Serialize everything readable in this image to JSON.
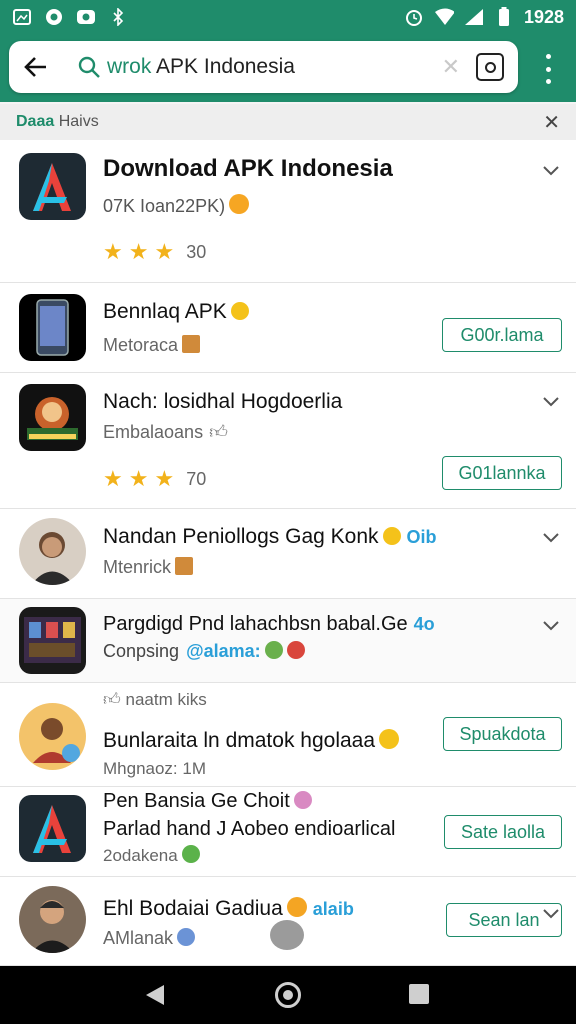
{
  "status": {
    "time": "1928"
  },
  "search": {
    "query_prefix": "wrok",
    "query_rest": " APK Indonesia"
  },
  "filter": {
    "label_bold": "Daaa",
    "label_rest": " Haivs"
  },
  "items": [
    {
      "title": "Download APK Indonesia",
      "subtitle": "07K Ioan22PK)",
      "stars": 3,
      "rating": "30"
    },
    {
      "title": "Bennlaq APK",
      "subtitle": "Metoraca",
      "button": "G00r.lama"
    },
    {
      "title": "Nach: losidhal Hogdoerlia",
      "subtitle": "Embalaoans",
      "stars": 3,
      "rating": "70",
      "button": "G01lannka"
    },
    {
      "title": "Nandan Peniollogs Gag Konk",
      "tag": "Oib",
      "subtitle": "Mtenrick"
    },
    {
      "title": "Pargdigd Pnd lahachbsn babal.Ge",
      "tag": "4o",
      "subtitle": "Conpsing",
      "subtitle_tag": "@alama:"
    },
    {
      "above": "naatm kiks",
      "title": "Bunlaraita ln dmatok hgolaaa",
      "subtitle": "Mhgnaoz: 1M",
      "button": "Spuakdota"
    },
    {
      "title": "Pen Bansia Ge Choit",
      "title2": "Parlad hand J Aobeo endioarlical",
      "subtitle": "2odakena",
      "button": "Sate laolla"
    },
    {
      "title": "Ehl Bodaiai Gadiua",
      "tag": "alaib",
      "subtitle": "AMlanak",
      "button": "Sean lan"
    }
  ],
  "colors": {
    "accent": "#1f8c6b",
    "star": "#f2b21b",
    "tag": "#2a9fd8"
  }
}
